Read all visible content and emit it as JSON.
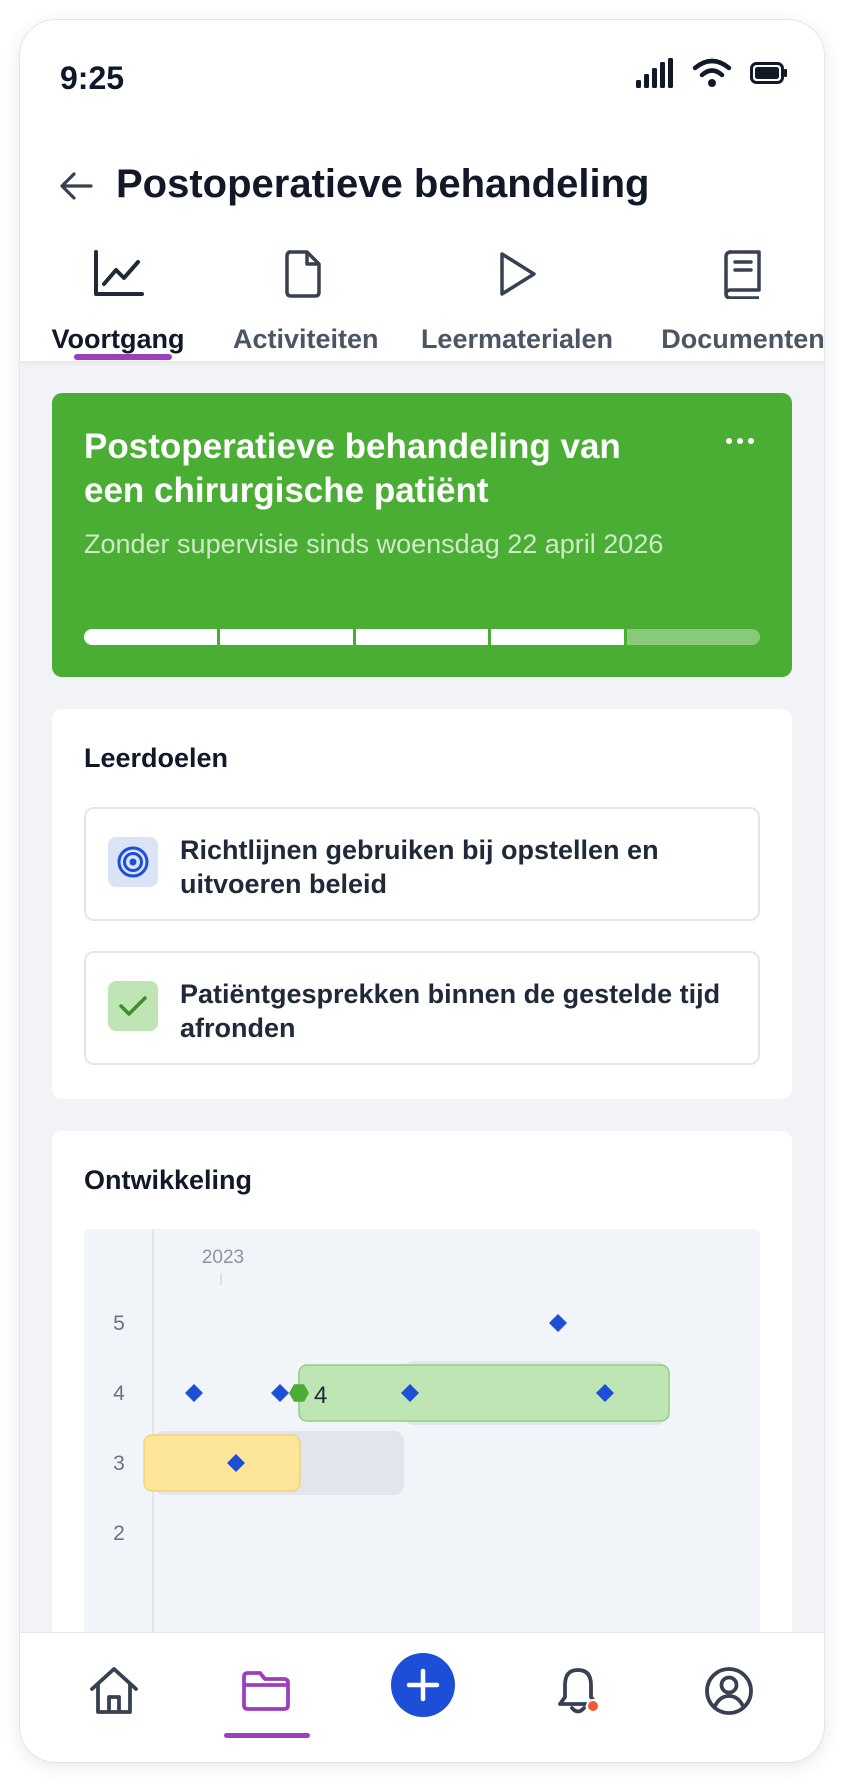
{
  "status": {
    "time": "9:25"
  },
  "header": {
    "title": "Postoperatieve behandeling"
  },
  "tabs": [
    {
      "label": "Voortgang",
      "icon": "chart-line-icon",
      "active": true
    },
    {
      "label": "Activiteiten",
      "icon": "document-icon",
      "active": false
    },
    {
      "label": "Leermaterialen",
      "icon": "play-icon",
      "active": false
    },
    {
      "label": "Documenten",
      "icon": "book-icon",
      "active": false
    }
  ],
  "hero": {
    "title": "Postoperatieve behandeling  van een chirurgische patiënt",
    "subtitle": "Zonder supervisie sinds woensdag 22 april 2026",
    "progress": {
      "filled_segments": 4,
      "total_segments": 5
    },
    "color": "#4aad34"
  },
  "goals": {
    "title": "Leerdoelen",
    "items": [
      {
        "text": "Richtlijnen gebruiken bij opstellen en uitvoeren beleid",
        "icon": "target-icon",
        "status": "in-progress"
      },
      {
        "text": "Patiëntgesprekken binnen de gestelde tijd afronden",
        "icon": "check-icon",
        "status": "completed"
      }
    ]
  },
  "development": {
    "title": "Ontwikkeling"
  },
  "chart_data": {
    "type": "scatter",
    "x_tick_labels": [
      "2023"
    ],
    "y_ticks": [
      2,
      3,
      4,
      5
    ],
    "level_marker": {
      "value": 4,
      "label": "4"
    },
    "points": [
      {
        "order": 1,
        "y": 4
      },
      {
        "order": 2,
        "y": 3
      },
      {
        "order": 3,
        "y": 4
      },
      {
        "order": 4,
        "y": 4
      },
      {
        "order": 5,
        "y": 5
      },
      {
        "order": 6,
        "y": 4
      }
    ],
    "bands": [
      {
        "level": 3,
        "color": "#fde59a"
      },
      {
        "level": 4,
        "color": "#bfe5b5"
      }
    ],
    "colors": {
      "point": "#1d4ed8",
      "marker": "#4aad34"
    }
  },
  "nav": {
    "items": [
      "home-icon",
      "folder-icon",
      "plus-icon",
      "bell-icon",
      "user-circle-icon"
    ],
    "active": "folder-icon",
    "accent": "#9b3fbd"
  }
}
